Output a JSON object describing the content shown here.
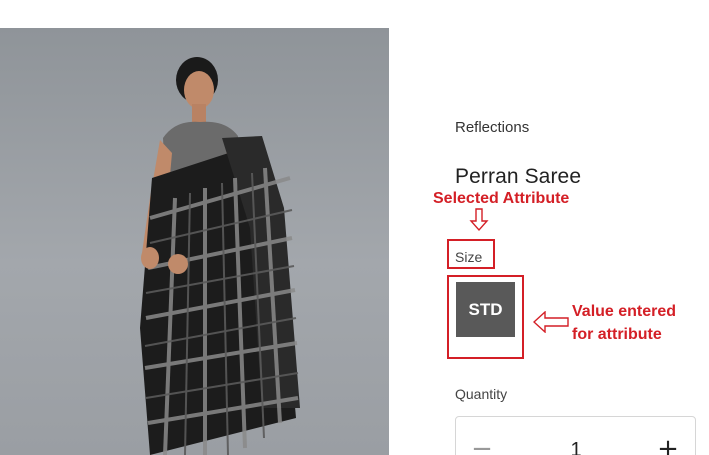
{
  "product": {
    "brand": "Reflections",
    "title": "Perran Saree",
    "image_alt": "model-wearing-black-grey-check-saree"
  },
  "attribute": {
    "label": "Size",
    "selected_value": "STD"
  },
  "quantity": {
    "label": "Quantity",
    "value": "1",
    "minus_label": "−",
    "plus_label": "+"
  },
  "annotations": {
    "selected_attribute": "Selected Attribute",
    "value_entered_line1": "Value entered",
    "value_entered_line2": "for attribute",
    "color": "#d41f26"
  },
  "colors": {
    "swatch_bg": "#595959",
    "image_bg": "#9a9ea3"
  }
}
